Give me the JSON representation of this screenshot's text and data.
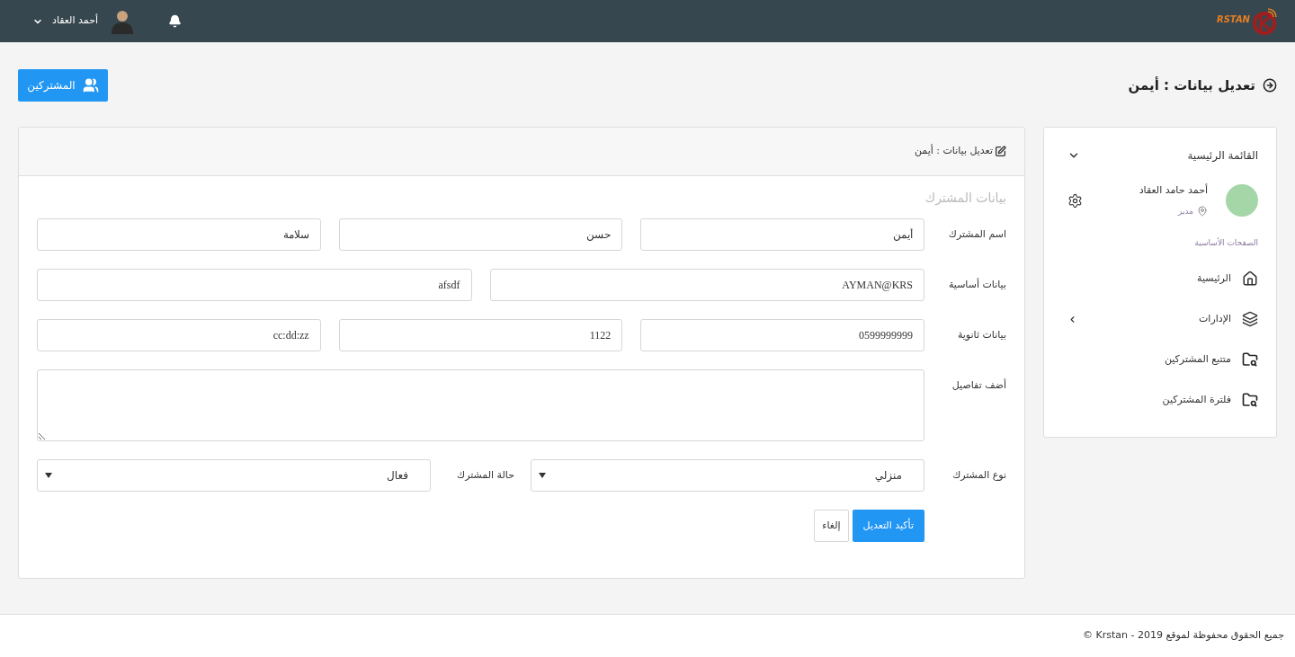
{
  "header": {
    "logo_text": "RSTAN",
    "user_name": "أحمد العقاد"
  },
  "page_title": "تعديل بيانات : أيمن",
  "subscribers_button": "المشتركين",
  "sidebar": {
    "title": "القائمة الرئيسية",
    "profile": {
      "name": "أحمد حامد العقاد",
      "role": "مدير"
    },
    "section": "الصفحات الأساسية",
    "items": [
      {
        "label": "الرئيسية",
        "kind": "home",
        "has_children": false
      },
      {
        "label": "الإدارات",
        "kind": "layers",
        "has_children": true
      },
      {
        "label": "متتبع المشتركين",
        "kind": "folder-search",
        "has_children": false
      },
      {
        "label": "فلترة المشتركين",
        "kind": "folder-search",
        "has_children": false
      }
    ]
  },
  "form": {
    "title": "تعديل بيانات : أيمن",
    "section": "بيانات المشترك",
    "rows": [
      {
        "label": "اسم المشترك",
        "kind": "inputs",
        "fields": [
          {
            "value": "أيمن"
          },
          {
            "value": "حسن"
          },
          {
            "value": "سلامة"
          }
        ]
      },
      {
        "label": "بيانات أساسية",
        "kind": "inputs",
        "fields": [
          {
            "value": "AYMAN@KRS"
          },
          {
            "value": "afsdf"
          }
        ]
      },
      {
        "label": "بيانات ثانوية",
        "kind": "inputs",
        "fields": [
          {
            "value": "0599999999"
          },
          {
            "value": "1122"
          },
          {
            "value": "cc:dd:zz"
          }
        ]
      },
      {
        "label": "أضف تفاصيل",
        "kind": "textarea"
      },
      {
        "label": "نوع المشترك",
        "kind": "selects",
        "fields": [
          {
            "value": "منزلي"
          },
          {
            "label": "حالة المشترك",
            "value": "فعال"
          }
        ]
      }
    ],
    "buttons": [
      {
        "label": "تأكيد التعديل",
        "kind": "primary"
      },
      {
        "label": "إلغاء",
        "kind": "default"
      }
    ]
  },
  "footer": "جميع الحقوق محفوظة لموقع 2019 - Krstan ©"
}
